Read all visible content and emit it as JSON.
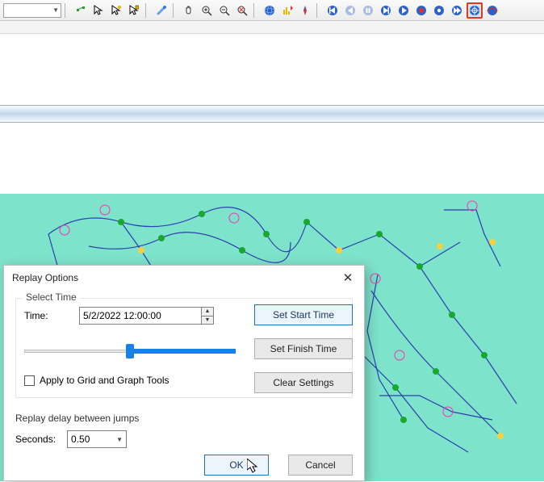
{
  "toolbar": {
    "combo_value": "",
    "buttons": [
      "element-select-icon",
      "arrow-pointer-icon",
      "arrow-hover-icon",
      "arrow-click-icon",
      "paintbrush-icon",
      "pan-hand-icon",
      "zoom-in-icon",
      "zoom-out-icon",
      "zoom-extent-icon",
      "globe-icon",
      "globe-stats-icon",
      "compass-icon",
      "skip-back-icon",
      "step-back-icon",
      "pause-icon",
      "step-forward-icon",
      "play-icon",
      "record-icon",
      "record-alt-icon",
      "skip-forward-icon",
      "marker-icon",
      "globe-replay-icon"
    ]
  },
  "dialog": {
    "title": "Replay Options",
    "select_time_label": "Select Time",
    "time_label": "Time:",
    "time_value": "5/2/2022 12:00:00",
    "set_start_label": "Set Start Time",
    "set_finish_label": "Set Finish Time",
    "clear_label": "Clear Settings",
    "apply_label": "Apply to Grid and Graph Tools",
    "apply_checked": false,
    "delay_group_label": "Replay delay between jumps",
    "seconds_label": "Seconds:",
    "seconds_value": "0.50",
    "ok_label": "OK",
    "cancel_label": "Cancel",
    "slider_position_pct": 50
  }
}
